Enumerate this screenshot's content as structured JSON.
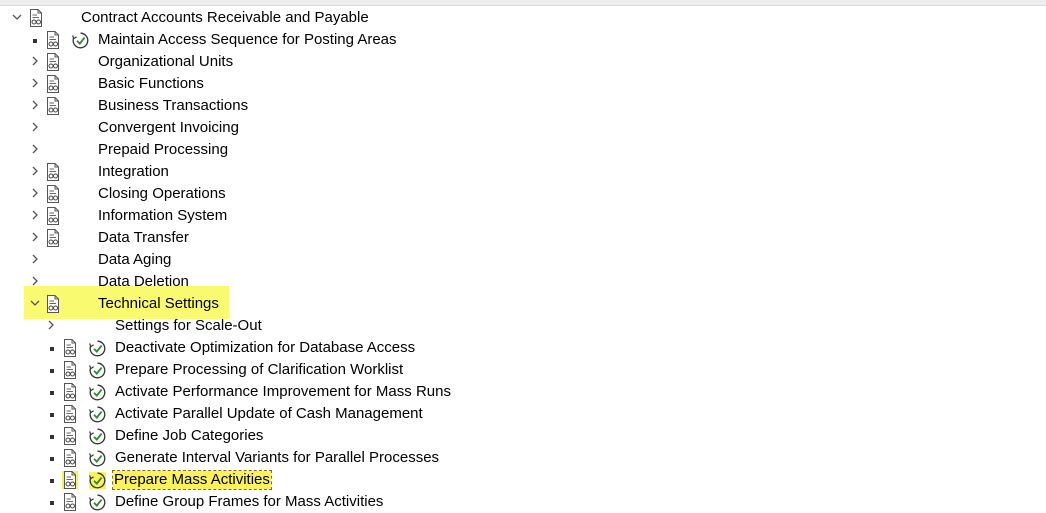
{
  "root": {
    "label": "Contract Accounts Receivable and Payable"
  },
  "level1": [
    {
      "label": "Maintain Access Sequence for Posting Areas"
    },
    {
      "label": "Organizational Units"
    },
    {
      "label": "Basic Functions"
    },
    {
      "label": "Business Transactions"
    },
    {
      "label": "Convergent Invoicing"
    },
    {
      "label": "Prepaid Processing"
    },
    {
      "label": "Integration"
    },
    {
      "label": "Closing Operations"
    },
    {
      "label": "Information System"
    },
    {
      "label": "Data Transfer"
    },
    {
      "label": "Data Aging"
    },
    {
      "label": "Data Deletion"
    },
    {
      "label": "Technical Settings"
    }
  ],
  "level2": [
    {
      "label": "Settings for Scale-Out"
    },
    {
      "label": "Deactivate Optimization for Database Access"
    },
    {
      "label": "Prepare Processing of Clarification Worklist"
    },
    {
      "label": "Activate Performance Improvement for Mass Runs"
    },
    {
      "label": "Activate Parallel Update of Cash Management"
    },
    {
      "label": "Define Job Categories"
    },
    {
      "label": "Generate Interval Variants for Parallel Processes"
    },
    {
      "label": "Prepare Mass Activities"
    },
    {
      "label": "Define Group Frames for Mass Activities"
    }
  ],
  "colors": {
    "highlight": "#fafa60",
    "selected": "#fbf15a",
    "clock_green": "#2e8b2e"
  }
}
